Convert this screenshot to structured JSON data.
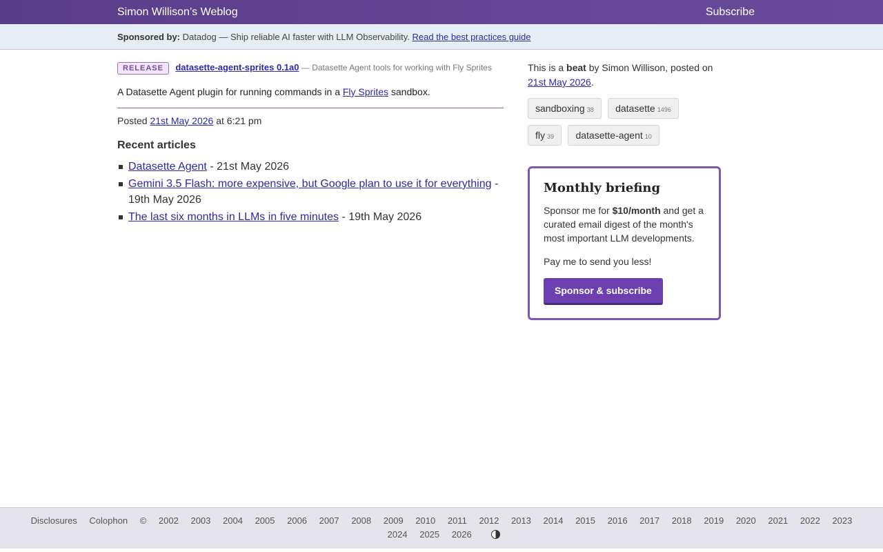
{
  "header": {
    "site_title": "Simon Willison’s Weblog",
    "subscribe": "Subscribe"
  },
  "sponsor": {
    "label": "Sponsored by:",
    "text": "Datadog — Ship reliable AI faster with LLM Observability.",
    "link": "Read the best practices guide"
  },
  "release": {
    "badge": "RELEASE",
    "title": "datasette-agent-sprites 0.1a0",
    "dash": "—",
    "description": "Datasette Agent tools for working with Fly Sprites"
  },
  "body": {
    "prefix": "A Datasette Agent plugin for running commands in a",
    "link": "Fly Sprites",
    "suffix": "sandbox."
  },
  "posted": {
    "label": "Posted",
    "date": "21st May 2026",
    "time": "at 6:21 pm"
  },
  "recent": {
    "heading": "Recent articles",
    "items": [
      {
        "title": "Datasette Agent",
        "date": "- 21st May 2026"
      },
      {
        "title": "Gemini 3.5 Flash: more expensive, but Google plan to use it for everything",
        "date": "- 19th May 2026"
      },
      {
        "title": "The last six months in LLMs in five minutes",
        "date": "- 19th May 2026"
      }
    ]
  },
  "sidebar": {
    "beat_prefix": "This is a",
    "beat_word": "beat",
    "beat_suffix": "by Simon Willison, posted on",
    "beat_date": "21st May 2026",
    "beat_end": ".",
    "tags": [
      {
        "name": "sandboxing",
        "count": "38"
      },
      {
        "name": "datasette",
        "count": "1496"
      },
      {
        "name": "fly",
        "count": "39"
      },
      {
        "name": "datasette-agent",
        "count": "10"
      }
    ]
  },
  "briefing": {
    "title": "Monthly briefing",
    "text_prefix": "Sponsor me for",
    "price": "$10/month",
    "text_suffix": "and get a curated email digest of the month's most important LLM developments.",
    "text2": "Pay me to send you less!",
    "button": "Sponsor & subscribe"
  },
  "footer": {
    "disclosures": "Disclosures",
    "colophon": "Colophon",
    "copyright": "©",
    "years": [
      "2002",
      "2003",
      "2004",
      "2005",
      "2006",
      "2007",
      "2008",
      "2009",
      "2010",
      "2011",
      "2012",
      "2013",
      "2014",
      "2015",
      "2016",
      "2017",
      "2018",
      "2019",
      "2020",
      "2021",
      "2022",
      "2023",
      "2024",
      "2025",
      "2026"
    ]
  },
  "colors": {
    "header_bg": "#6b4a9c",
    "sponsor_bg": "#e6edf5",
    "link": "#2a2aaa",
    "briefing_border": "#7a5ab0",
    "button_bg": "#6b3fb0"
  }
}
